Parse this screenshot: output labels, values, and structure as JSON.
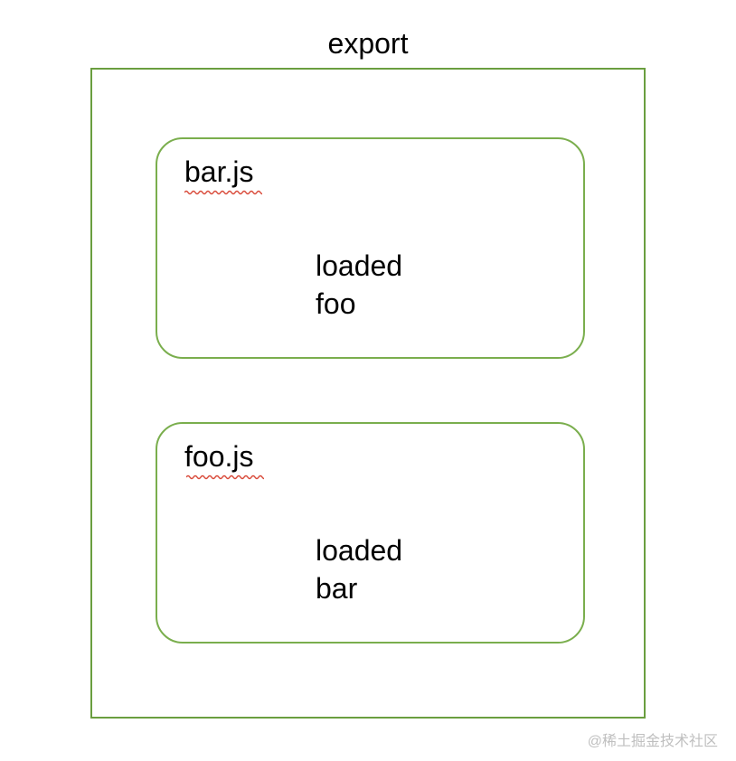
{
  "title": "export",
  "modules": [
    {
      "name": "bar.js",
      "content_line1": "loaded",
      "content_line2": "foo"
    },
    {
      "name": "foo.js",
      "content_line1": "loaded",
      "content_line2": "bar"
    }
  ],
  "watermark": "@稀土掘金技术社区",
  "colors": {
    "border_outer": "#6a9e3f",
    "border_inner": "#7aae4d",
    "squiggle": "#d94a3a"
  }
}
